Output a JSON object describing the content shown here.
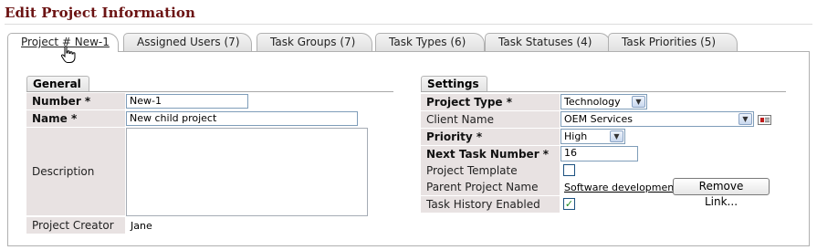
{
  "page": {
    "title": "Edit Project Information"
  },
  "tabs": [
    {
      "label": "Project # New-1",
      "active": true
    },
    {
      "label": "Assigned Users (7)"
    },
    {
      "label": "Task Groups (7)"
    },
    {
      "label": "Task Types (6)"
    },
    {
      "label": "Task Statuses (4)"
    },
    {
      "label": "Task Priorities (5)"
    }
  ],
  "general": {
    "header": "General",
    "number": {
      "label": "Number *",
      "value": "New-1"
    },
    "name": {
      "label": "Name *",
      "value": "New child project"
    },
    "description": {
      "label": "Description",
      "value": ""
    },
    "creator": {
      "label": "Project Creator",
      "value": "Jane"
    }
  },
  "settings": {
    "header": "Settings",
    "project_type": {
      "label": "Project Type *",
      "value": "Technology"
    },
    "client_name": {
      "label": "Client Name",
      "value": "OEM Services"
    },
    "priority": {
      "label": "Priority *",
      "value": "High"
    },
    "next_task_number": {
      "label": "Next Task Number *",
      "value": "16"
    },
    "project_template": {
      "label": "Project Template",
      "checked": false
    },
    "parent_project": {
      "label": "Parent Project Name",
      "value": "Software development",
      "remove_label": "Remove Link..."
    },
    "task_history": {
      "label": "Task History Enabled",
      "checked": true,
      "mark": "✓"
    }
  },
  "icons": {
    "client_card": "contact-card-icon",
    "cursor": "hand-pointer-icon",
    "dropdown": "chevron-down-icon"
  },
  "colors": {
    "title": "#6b1212",
    "label_bg": "#e8e2e2",
    "check": "#1f8a1f"
  }
}
